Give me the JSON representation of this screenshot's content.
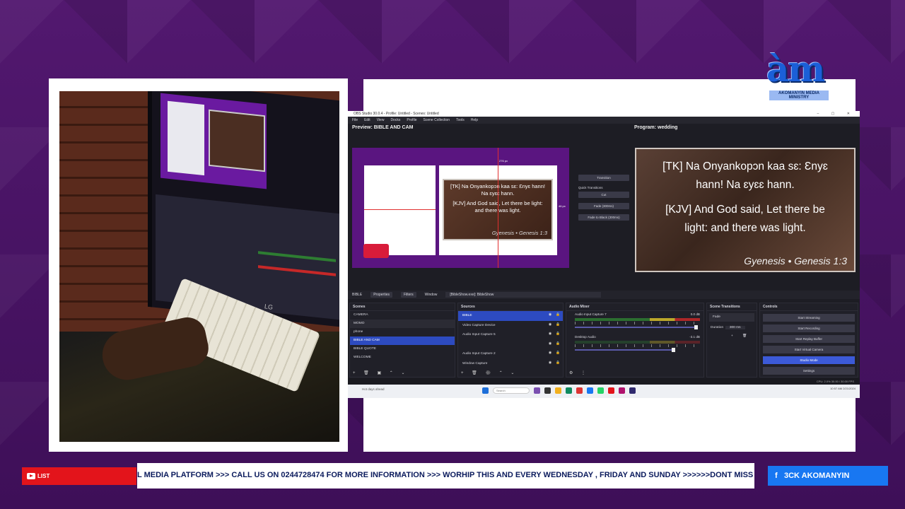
{
  "colors": {
    "background": "#4a1466",
    "ticker_text": "#0a1a5c",
    "live_red": "#e3141b",
    "facebook_blue": "#1877f2",
    "obs_selected": "#2d4bc0"
  },
  "logo": {
    "big_text": "àm",
    "small_text": "AKOMANYIN MEDIA MINISTRY"
  },
  "camera": {
    "monitor_brand": "LG"
  },
  "obs": {
    "window_title": "OBS Studio 30.0.4 - Profile: Untitled - Scenes: Untitled",
    "menu": [
      "File",
      "Edit",
      "View",
      "Docks",
      "Profile",
      "Scene Collection",
      "Tools",
      "Help"
    ],
    "preview_label": "Preview: BIBLE AND CAM",
    "program_label": "Program: wedding",
    "preview_slide": {
      "line1": "[TK] Na Onyankopɔn kaa sɛ: Ɛnyɛ hann! Na ɛyɛɛ hann.",
      "line2": "[KJV] And God said, Let there be light: and there was light.",
      "ref": "Gyenesis • Genesis 1:3"
    },
    "program_slide": {
      "line1a": "[TK] Na Onyankopɔn kaa sɛ: Ɛnyɛ",
      "line1b": "hann! Na ɛyɛɛ hann.",
      "line2a": "[KJV] And God said, Let there be",
      "line2b": "light: and there was light.",
      "ref": "Gyenesis • Genesis 1:3"
    },
    "preview_sizes": {
      "top": "276 px",
      "left": "808 px",
      "right": "46 px",
      "bottom": "570 px"
    },
    "transition_panel": {
      "transition_btn": "Transition",
      "quick_label": "Quick Transitions",
      "cut": "Cut",
      "fade": "Fade (300ms)",
      "fade_black": "Fade to Black (300ms)"
    },
    "source_bar": {
      "current": "BIBLE",
      "properties": "Properties",
      "filters": "Filters",
      "window_label": "Window",
      "window_value": "[BibleShow.exe]: BibleShow"
    },
    "scenes": {
      "header": "Scenes",
      "items": [
        "CAMERA",
        "MOMO",
        "phone",
        "BIBLE AND CAM",
        "BIBLE QUOTE",
        "WELCOME"
      ],
      "selected_index": 3
    },
    "sources": {
      "header": "Sources",
      "items": [
        "BIBLE",
        "Video Capture Device",
        "Audio Input Capture 5",
        "",
        "Audio Input Capture 2",
        "Window Capture"
      ]
    },
    "audio_mixer": {
      "header": "Audio Mixer",
      "ch1_name": "Audio Input Capture 7",
      "ch1_db": "0.0 dB",
      "ch2_name": "Desktop Audio",
      "ch2_db": "-3.1 dB"
    },
    "scene_transitions": {
      "header": "Scene Transitions",
      "type": "Fade",
      "duration_label": "Duration",
      "duration": "300 ms"
    },
    "controls": {
      "header": "Controls",
      "start_streaming": "Start Streaming",
      "start_recording": "Start Recording",
      "start_replay": "Start Replay Buffer",
      "start_virtual_cam": "Start Virtual Camera",
      "studio_mode": "Studio Mode",
      "settings": "Settings"
    },
    "status": "CPU: 2.0%   30.00 / 30.00 FPS",
    "taskbar": {
      "weather": "Hot days ahead",
      "search": "Search",
      "clock": "10:57 AM\n2/21/2024"
    }
  },
  "ticker": {
    "live_label": "LIST",
    "text": "L MEDIA PLATFORM >>> CALL US ON 0244728474 FOR MORE INFORMATION >>> WORHIP THIS AND EVERY WEDNESDAY , FRIDAY AND SUNDAY >>>>>>DONT MISS O",
    "facebook_label": "3CK AKOMANYIN"
  }
}
